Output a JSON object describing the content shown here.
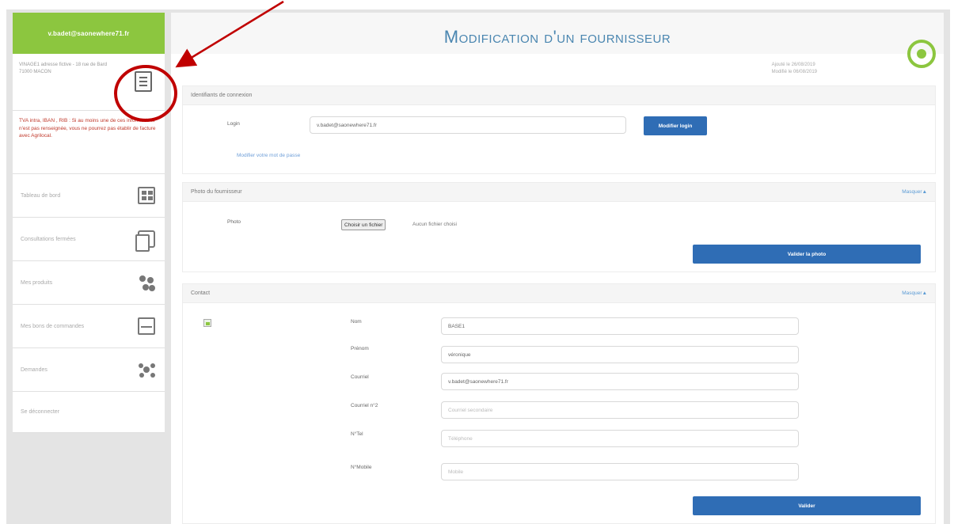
{
  "sidebar": {
    "user_email": "v.badet@saonewhere71.fr",
    "address": "VINAGE1 adresse fictive - 18 rue de Bard 71000 MACON",
    "warning": "TVA intra, IBAN , RIB : Si au moins une de ces informations n'est pas renseignée, vous ne pourrez pas établir de facture avec Agrilocal.",
    "nav": [
      {
        "label": "Tableau de bord",
        "icon": "dashboard-icon"
      },
      {
        "label": "Consultations fermées",
        "icon": "documents-icon"
      },
      {
        "label": "Mes produits",
        "icon": "products-icon"
      },
      {
        "label": "Mes bons de commandes",
        "icon": "order-form-icon"
      },
      {
        "label": "Demandes",
        "icon": "requests-icon"
      },
      {
        "label": "Se déconnecter",
        "icon": ""
      }
    ]
  },
  "header": {
    "title": "Modification d'un fournisseur",
    "added": "Ajouté le 26/08/2019",
    "modified": "Modifié le 06/08/2019"
  },
  "login_panel": {
    "title": "Identifiants de connexion",
    "login_label": "Login",
    "login_value": "v.badet@saonewhere71.fr",
    "modify_login_button": "Modifier login",
    "change_password_link": "Modifier votre mot de passe"
  },
  "photo_panel": {
    "title": "Photo du fournisseur",
    "toggle": "Masquer",
    "photo_label": "Photo",
    "file_button": "Choisir un fichier",
    "file_status": "Aucun fichier choisi",
    "validate_button": "Valider la photo"
  },
  "contact_panel": {
    "title": "Contact",
    "toggle": "Masquer",
    "fields": [
      {
        "label": "Nom",
        "value": "BASE1",
        "placeholder": ""
      },
      {
        "label": "Prénom",
        "value": "véronique",
        "placeholder": ""
      },
      {
        "label": "Courriel",
        "value": "v.badet@saonewhere71.fr",
        "placeholder": ""
      },
      {
        "label": "Courriel n°2",
        "value": "",
        "placeholder": "Courriel secondaire"
      },
      {
        "label": "N°Tel",
        "value": "",
        "placeholder": "Téléphone"
      },
      {
        "label": "N°Mobile",
        "value": "",
        "placeholder": "Mobile"
      }
    ],
    "validate_button": "Valider"
  },
  "colors": {
    "accent_green": "#8cc63f",
    "primary_blue": "#2f6db5",
    "annotation_red": "#c00000"
  }
}
